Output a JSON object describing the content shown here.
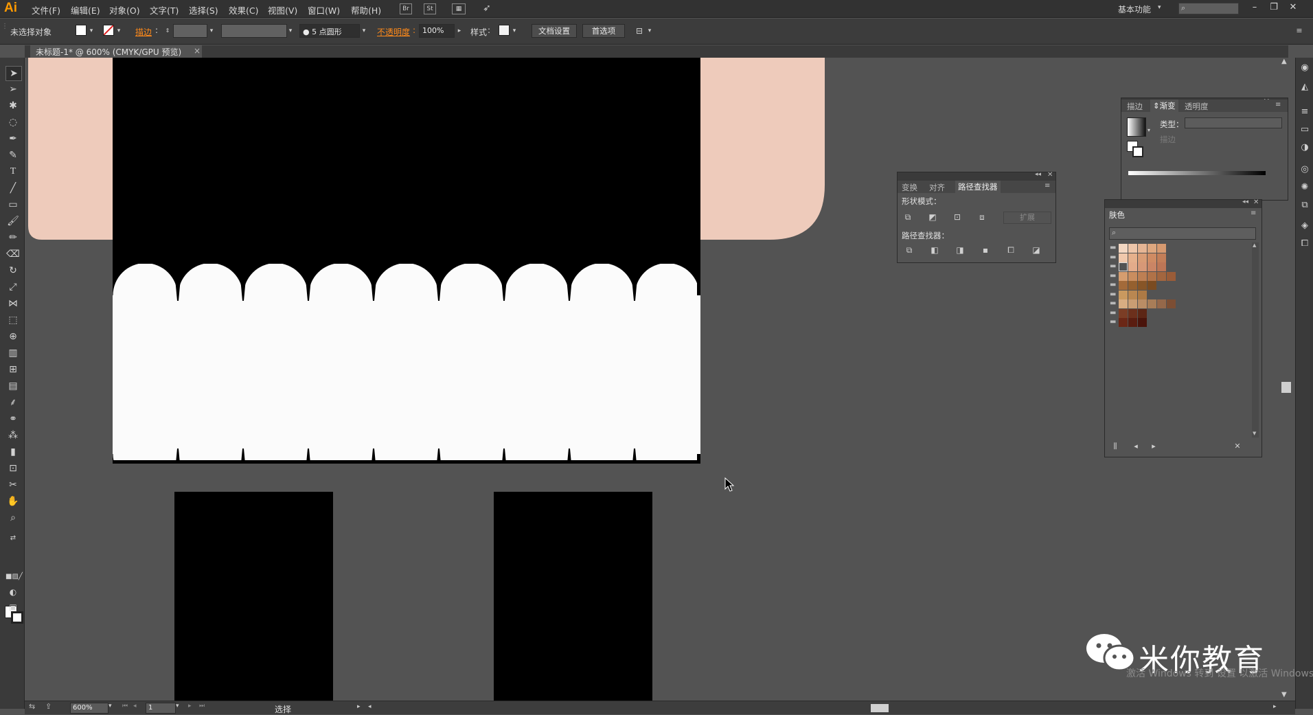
{
  "app": {
    "logo": "Ai"
  },
  "menu": [
    "文件(F)",
    "编辑(E)",
    "对象(O)",
    "文字(T)",
    "选择(S)",
    "效果(C)",
    "视图(V)",
    "窗口(W)",
    "帮助(H)"
  ],
  "menubar": {
    "br_label": "Br",
    "st_label": "St",
    "workspace": "基本功能"
  },
  "control": {
    "selection": "未选择对象",
    "stroke_label": "描边",
    "brush": "5 点圆形",
    "opacity_label": "不透明度",
    "opacity": "100%",
    "style_label": "样式",
    "doc_setup": "文档设置",
    "prefs": "首选项"
  },
  "document": {
    "tab_title": "未标题-1* @ 600% (CMYK/GPU 预览)",
    "close": "×"
  },
  "status": {
    "zoom": "600%",
    "artboard": "1",
    "mode": "选择"
  },
  "pathfinder_panel": {
    "tabs": [
      "变换",
      "对齐",
      "路径查找器"
    ],
    "shape_modes": "形状模式：",
    "expand": "扩展",
    "pathfinders": "路径查找器："
  },
  "gradient_panel": {
    "tabs": [
      "描边",
      "渐变",
      "透明度"
    ],
    "type_label": "类型：",
    "stroke_label": "描边"
  },
  "swatch_panel": {
    "title": "肤色",
    "rows": [
      [
        "#f3d7c2",
        "#eec6aa",
        "#e6b594",
        "#dea77f",
        "#d79a70"
      ],
      [
        "#f0c8ac",
        "#e5b08c",
        "#d99c75",
        "#cf8b63",
        "#c37e58"
      ],
      [
        "#ffffff",
        "#e3ab8a",
        "#d79877",
        "#ca8565",
        "#bd7656"
      ],
      [
        "#d59d6f",
        "#c98d5f",
        "#bd7f53",
        "#b07248",
        "#a3663f",
        "#9a5c38"
      ],
      [
        "#a36a3a",
        "#95602f",
        "#875527",
        "#7a4b21"
      ],
      [
        "#c9995f",
        "#b98751",
        "#ad7a45"
      ],
      [
        "#d8ad82",
        "#c99d73",
        "#ba8d65",
        "#a87d58",
        "#95684a",
        "#7c4e34"
      ],
      [
        "#7b3d25",
        "#6c301c",
        "#5c2615"
      ],
      [
        "#6b2716",
        "#5a1d10",
        "#4a140b"
      ]
    ]
  },
  "watermark": {
    "text": "米你教育",
    "sub": "激活 Windows 转到 设置 以激活 Windows。"
  },
  "colors": {
    "skin": "#eecbbb",
    "canvas_bg": "#535353",
    "ui_dark": "#323232",
    "accent": "#ff9a00"
  }
}
